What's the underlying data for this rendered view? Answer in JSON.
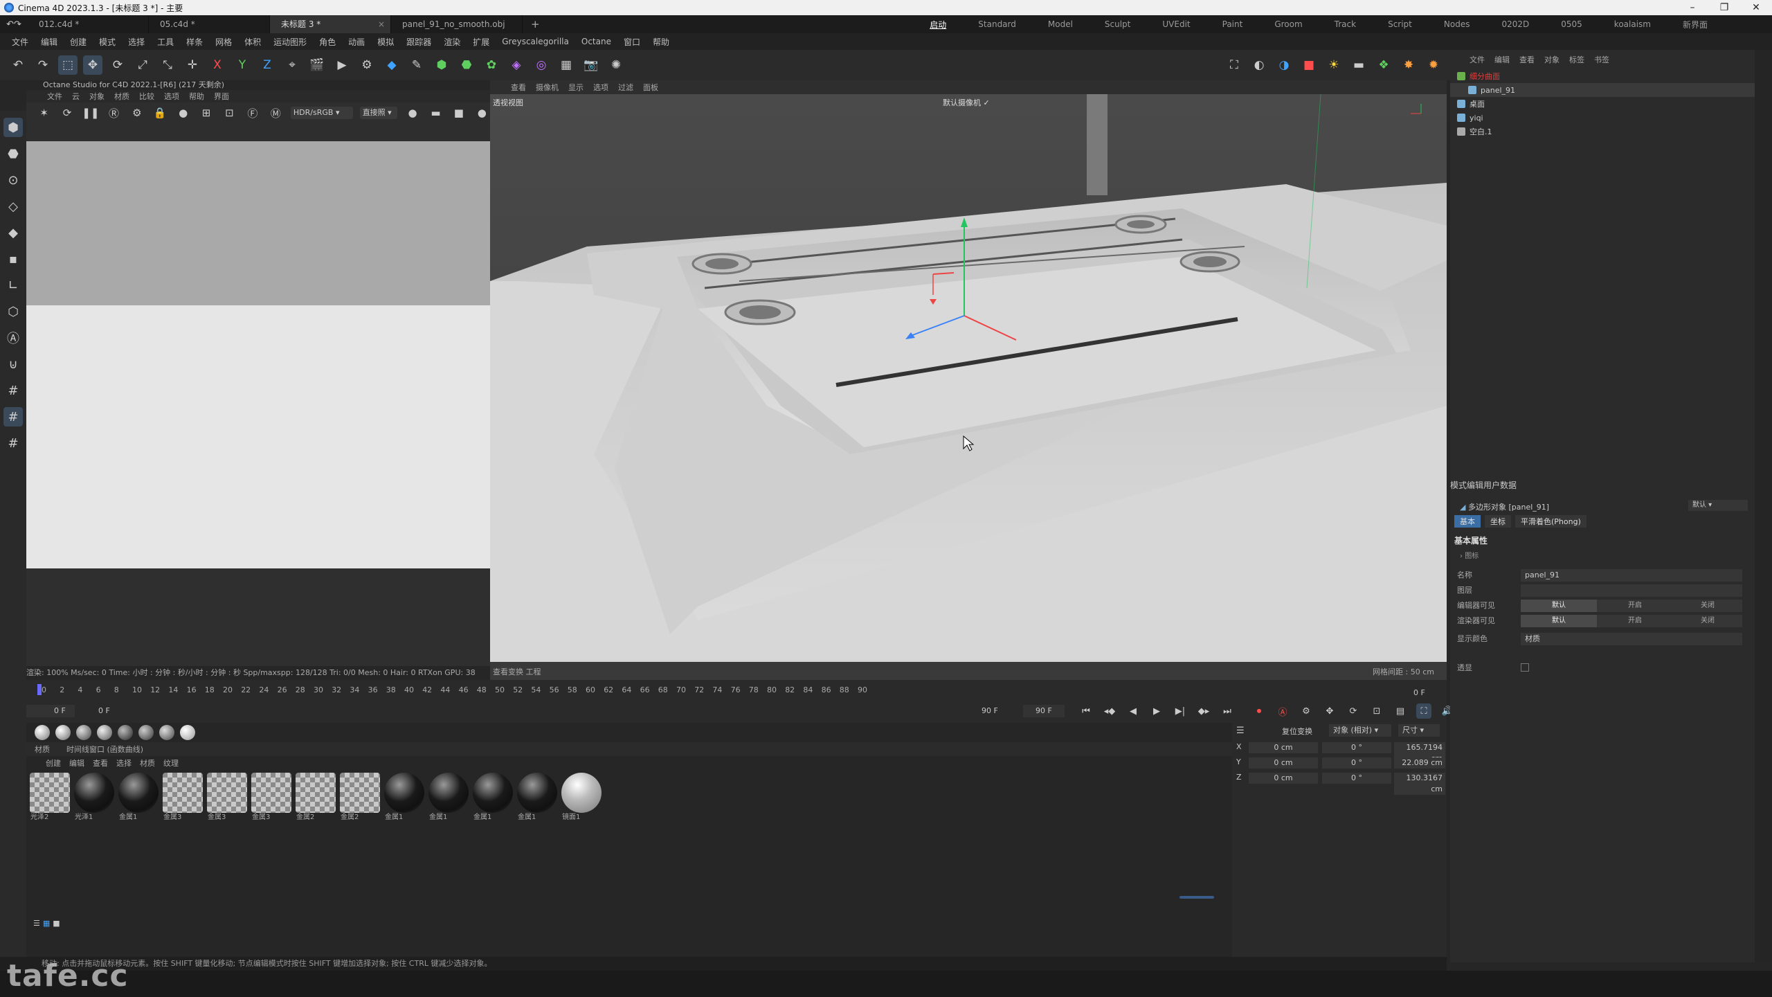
{
  "window": {
    "title": "Cinema 4D 2023.1.3 - [未标题 3 *] - 主要"
  },
  "doc_tabs": [
    {
      "label": "012.c4d *"
    },
    {
      "label": "05.c4d *"
    },
    {
      "label": "未标题 3 *"
    },
    {
      "label": "panel_91_no_smooth.obj *"
    }
  ],
  "layouts": [
    "启动",
    "Standard",
    "Model",
    "Sculpt",
    "UVEdit",
    "Paint",
    "Groom",
    "Track",
    "Script",
    "Nodes",
    "0202D",
    "0505",
    "koalaism"
  ],
  "layout_new": "新界面",
  "menu": [
    "文件",
    "编辑",
    "创建",
    "模式",
    "选择",
    "工具",
    "样条",
    "网格",
    "体积",
    "运动图形",
    "角色",
    "动画",
    "模拟",
    "跟踪器",
    "渲染",
    "扩展",
    "Greyscalegorilla",
    "Octane",
    "窗口",
    "帮助"
  ],
  "octane": {
    "title": "Octane Studio for C4D 2022.1-[R6] (217 天剩余)",
    "menu": [
      "文件",
      "云",
      "对象",
      "材质",
      "比较",
      "选项",
      "帮助",
      "界面"
    ],
    "colorspace": "HDR/sRGB",
    "mode": "直接照",
    "status": "渲染: 100%   Ms/sec: 0   Time: 小时 : 分钟 : 秒/小时 : 分钟 : 秒   Spp/maxspp: 128/128   Tri: 0/0   Mesh: 0   Hair: 0   RTXon   GPU: 38"
  },
  "viewport": {
    "menu": [
      "查看",
      "摄像机",
      "显示",
      "选项",
      "过滤",
      "面板"
    ],
    "title": "透视视图",
    "camera": "默认摄像机",
    "footer_left": "查看变换  工程",
    "grid": "网格间距 : 50 cm"
  },
  "timeline": {
    "ticks": [
      "0",
      "2",
      "4",
      "6",
      "8",
      "10",
      "12",
      "14",
      "16",
      "18",
      "20",
      "22",
      "24",
      "26",
      "28",
      "30",
      "32",
      "34",
      "36",
      "38",
      "40",
      "42",
      "44",
      "46",
      "48",
      "50",
      "52",
      "54",
      "56",
      "58",
      "60",
      "62",
      "64",
      "66",
      "68",
      "70",
      "72",
      "74",
      "76",
      "78",
      "80",
      "82",
      "84",
      "86",
      "88",
      "90"
    ],
    "current": "0 F",
    "start": "0 F",
    "end": "90 F",
    "end2": "90 F",
    "right_frame": "0 F"
  },
  "materials": {
    "tabs": [
      "材质",
      "时间线窗口 (函数曲线)"
    ],
    "menu": [
      "创建",
      "编辑",
      "查看",
      "选择",
      "材质",
      "纹理"
    ],
    "items": [
      {
        "label": "光泽2",
        "kind": "checker"
      },
      {
        "label": "光泽1",
        "kind": "dark"
      },
      {
        "label": "金属1",
        "kind": "dark"
      },
      {
        "label": "金属3",
        "kind": "checker"
      },
      {
        "label": "金属3",
        "kind": "checker"
      },
      {
        "label": "金属3",
        "kind": "checker"
      },
      {
        "label": "金属2",
        "kind": "checker"
      },
      {
        "label": "金属2",
        "kind": "checker"
      },
      {
        "label": "金属1",
        "kind": "dark"
      },
      {
        "label": "金属1",
        "kind": "dark"
      },
      {
        "label": "金属1",
        "kind": "dark"
      },
      {
        "label": "金属1",
        "kind": "dark"
      },
      {
        "label": "镜面1",
        "kind": "light"
      }
    ]
  },
  "coords": {
    "headers": [
      "复位变换",
      "对象 (相对)",
      "尺寸"
    ],
    "rows": [
      {
        "axis": "X",
        "pos": "0 cm",
        "rot": "0 °",
        "size": "165.7194 cm"
      },
      {
        "axis": "Y",
        "pos": "0 cm",
        "rot": "0 °",
        "size": "22.089 cm"
      },
      {
        "axis": "Z",
        "pos": "0 cm",
        "rot": "0 °",
        "size": "130.3167 cm"
      }
    ]
  },
  "object_manager": {
    "menu": [
      "文件",
      "编辑",
      "查看",
      "对象",
      "标签",
      "书签"
    ],
    "objects": [
      {
        "name": "细分曲面",
        "color": "#6ab04c"
      },
      {
        "name": "panel_91",
        "color": "#7ab0d8"
      },
      {
        "name": "桌面",
        "color": "#7ab0d8"
      },
      {
        "name": "yiqi",
        "color": "#7ab0d8"
      },
      {
        "name": "空白.1",
        "color": "#aaaaaa"
      }
    ]
  },
  "attributes": {
    "menu": [
      "模式",
      "编辑",
      "用户数据"
    ],
    "object_title": "多边形对象 [panel_91]",
    "preset": "默认",
    "tabs": [
      "基本",
      "坐标",
      "平滑着色(Phong)"
    ],
    "section": "基本属性",
    "subsection": "图标",
    "fields": {
      "name_label": "名称",
      "name_value": "panel_91",
      "layer_label": "图层",
      "editor_label": "编辑器可见",
      "render_label": "渲染器可见",
      "opt_default": "默认",
      "opt_on": "开启",
      "opt_off": "关闭",
      "color_label": "显示颜色",
      "color_value": "材质",
      "xray_label": "透显"
    }
  },
  "status_text": "移动: 点击并拖动鼠标移动元素。按住 SHIFT 键量化移动; 节点编辑模式时按住 SHIFT 键增加选择对象; 按住 CTRL 键减少选择对象。",
  "watermark": "tafe.cc"
}
